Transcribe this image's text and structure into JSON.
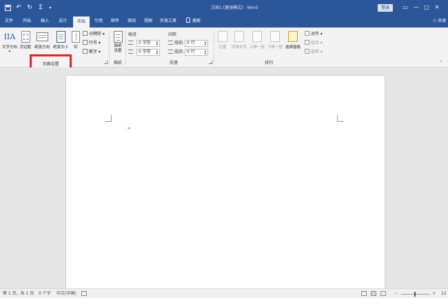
{
  "app": {
    "title": "文档1 [兼容模式] - Word",
    "signin": "登录",
    "share": "共享",
    "tell_me": "搜索",
    "window_buttons": [
      "—",
      "□",
      "✕"
    ],
    "quick_access": [
      "save-icon",
      "undo-icon",
      "redo-icon",
      "sigma-icon",
      "customize-icon"
    ]
  },
  "tabs": [
    {
      "label": "文件",
      "active": false
    },
    {
      "label": "开始",
      "active": false
    },
    {
      "label": "插入",
      "active": false
    },
    {
      "label": "设计",
      "active": false
    },
    {
      "label": "布局",
      "active": true
    },
    {
      "label": "引用",
      "active": false
    },
    {
      "label": "邮件",
      "active": false
    },
    {
      "label": "审阅",
      "active": false
    },
    {
      "label": "视图",
      "active": false
    },
    {
      "label": "开发工具",
      "active": false
    }
  ],
  "ribbon": {
    "page_setup": {
      "text_direction": "文字方向",
      "margins": "页边距",
      "orientation": "纸张方向",
      "size": "纸张大小",
      "columns": "栏",
      "breaks": "分隔符",
      "line_numbers": "行号",
      "hyphenation": "断字",
      "label": "页面设置"
    },
    "draft": {
      "button": "稿纸设置",
      "label": "稿纸"
    },
    "paragraph": {
      "indent_header": "缩进",
      "spacing_header": "间距",
      "left_value": "0 字符",
      "right_value": "0 字符",
      "before_label": "段前:",
      "before_value": "0 行",
      "after_label": "段后:",
      "after_value": "0 行",
      "label": "段落"
    },
    "arrange": {
      "position": "位置",
      "wrap_text": "环绕文字",
      "bring_forward": "上移一层",
      "send_backward": "下移一层",
      "selection_pane": "选择窗格",
      "align": "对齐",
      "group": "组合",
      "rotate": "旋转",
      "label": "排列"
    }
  },
  "highlight_label": "页面设置",
  "status_bar": {
    "page": "第 1 页，共 1 页",
    "words": "0 个字",
    "language": "中文(中国)",
    "zoom": "12"
  },
  "colors": {
    "accent": "#2b579a",
    "highlight_border": "#e02323"
  },
  "document": {
    "paragraph_mark": "↵"
  }
}
